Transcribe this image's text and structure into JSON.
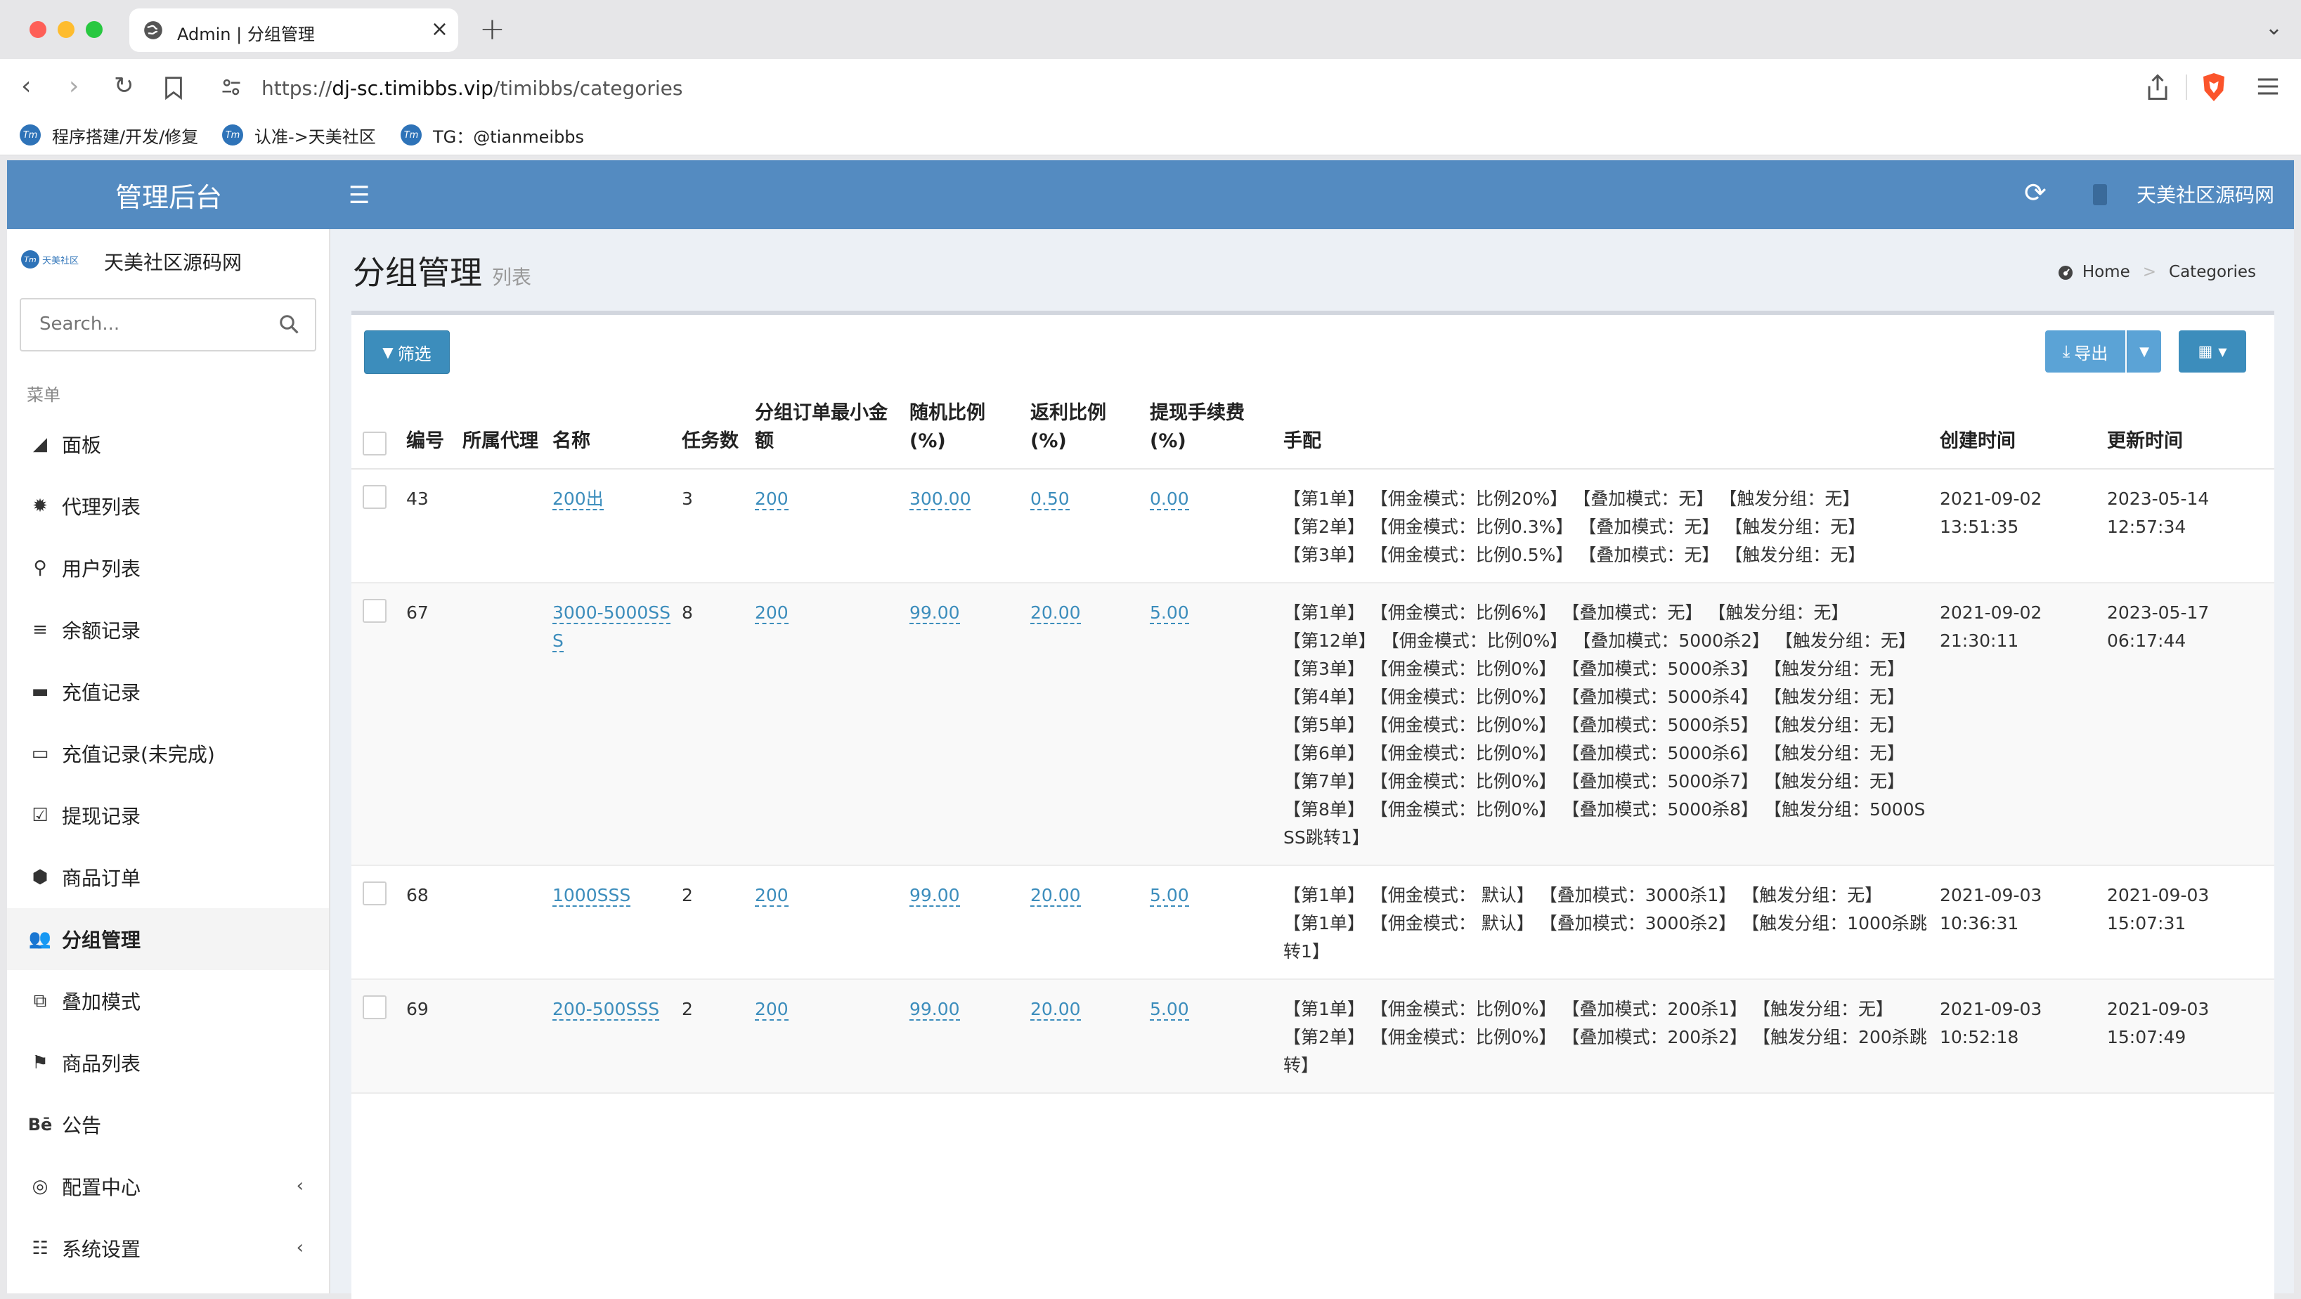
{
  "browser": {
    "tab_title": "Admin | 分组管理",
    "url_prefix": "https://",
    "url_host": "dj-sc.timibbs.vip",
    "url_path": "/timibbs/categories",
    "bookmarks": [
      {
        "label": "程序搭建/开发/修复"
      },
      {
        "label": "认准->天美社区"
      },
      {
        "label": "TG：@tianmeibbs"
      }
    ]
  },
  "header": {
    "brand": "管理后台",
    "user": "天美社区源码网"
  },
  "sidebar": {
    "logo_text": "天美社区",
    "site_name": "天美社区源码网",
    "search_placeholder": "Search...",
    "section": "菜单",
    "items": [
      {
        "label": "面板",
        "icon": "area-chart-icon"
      },
      {
        "label": "代理列表",
        "icon": "cog-icon"
      },
      {
        "label": "用户列表",
        "icon": "user-icon"
      },
      {
        "label": "余额记录",
        "icon": "bars-icon"
      },
      {
        "label": "充值记录",
        "icon": "battery-icon"
      },
      {
        "label": "充值记录(未完成)",
        "icon": "battery-empty-icon"
      },
      {
        "label": "提现记录",
        "icon": "check-square-icon"
      },
      {
        "label": "商品订单",
        "icon": "cube-icon"
      },
      {
        "label": "分组管理",
        "icon": "users-icon",
        "active": true
      },
      {
        "label": "叠加模式",
        "icon": "object-group-icon"
      },
      {
        "label": "商品列表",
        "icon": "wpexplorer-icon"
      },
      {
        "label": "公告",
        "icon": "behance-icon"
      },
      {
        "label": "配置中心",
        "icon": "life-ring-icon",
        "expandable": true
      },
      {
        "label": "系统设置",
        "icon": "server-icon",
        "expandable": true
      }
    ]
  },
  "page": {
    "title": "分组管理",
    "subtitle": "列表",
    "breadcrumb": [
      "Home",
      "Categories"
    ]
  },
  "toolbar": {
    "filter": "筛选",
    "export": "导出"
  },
  "table": {
    "headers": {
      "id": "编号",
      "agent": "所属代理",
      "name": "名称",
      "tasks": "任务数",
      "min_amount": "分组订单最小金额",
      "random_ratio": "随机比例(%)",
      "rebate_ratio": "返利比例(%)",
      "fee": "提现手续费(%)",
      "config": "手配",
      "created": "创建时间",
      "updated": "更新时间"
    },
    "rows": [
      {
        "id": "43",
        "agent": "",
        "name": "200出",
        "tasks": "3",
        "min_amount": "200",
        "random_ratio": "300.00",
        "rebate_ratio": "0.50",
        "fee": "0.00",
        "config": [
          "【第1单】 【佣金模式：比例20%】 【叠加模式：无】 【触发分组：无】",
          "【第2单】 【佣金模式：比例0.3%】 【叠加模式：无】 【触发分组：无】",
          "【第3单】 【佣金模式：比例0.5%】 【叠加模式：无】 【触发分组：无】"
        ],
        "created_date": "2021-09-02",
        "created_time": "13:51:35",
        "updated_date": "2023-05-14",
        "updated_time": "12:57:34"
      },
      {
        "id": "67",
        "agent": "",
        "name": "3000-5000SSS",
        "tasks": "8",
        "min_amount": "200",
        "random_ratio": "99.00",
        "rebate_ratio": "20.00",
        "fee": "5.00",
        "config": [
          "【第1单】 【佣金模式：比例6%】 【叠加模式：无】 【触发分组：无】",
          "【第12单】 【佣金模式：比例0%】 【叠加模式：5000杀2】 【触发分组：无】",
          "【第3单】 【佣金模式：比例0%】 【叠加模式：5000杀3】 【触发分组：无】",
          "【第4单】 【佣金模式：比例0%】 【叠加模式：5000杀4】 【触发分组：无】",
          "【第5单】 【佣金模式：比例0%】 【叠加模式：5000杀5】 【触发分组：无】",
          "【第6单】 【佣金模式：比例0%】 【叠加模式：5000杀6】 【触发分组：无】",
          "【第7单】 【佣金模式：比例0%】 【叠加模式：5000杀7】 【触发分组：无】",
          "【第8单】 【佣金模式：比例0%】 【叠加模式：5000杀8】 【触发分组：5000SSS跳转1】"
        ],
        "created_date": "2021-09-02",
        "created_time": "21:30:11",
        "updated_date": "2023-05-17",
        "updated_time": "06:17:44"
      },
      {
        "id": "68",
        "agent": "",
        "name": "1000SSS",
        "tasks": "2",
        "min_amount": "200",
        "random_ratio": "99.00",
        "rebate_ratio": "20.00",
        "fee": "5.00",
        "config": [
          "【第1单】 【佣金模式： 默认】 【叠加模式：3000杀1】 【触发分组：无】",
          "【第1单】 【佣金模式： 默认】 【叠加模式：3000杀2】 【触发分组：1000杀跳转1】"
        ],
        "created_date": "2021-09-03",
        "created_time": "10:36:31",
        "updated_date": "2021-09-03",
        "updated_time": "15:07:31"
      },
      {
        "id": "69",
        "agent": "",
        "name": "200-500SSS",
        "tasks": "2",
        "min_amount": "200",
        "random_ratio": "99.00",
        "rebate_ratio": "20.00",
        "fee": "5.00",
        "config": [
          "【第1单】 【佣金模式：比例0%】 【叠加模式：200杀1】 【触发分组：无】",
          "【第2单】 【佣金模式：比例0%】 【叠加模式：200杀2】 【触发分组：200杀跳转】"
        ],
        "created_date": "2021-09-03",
        "created_time": "10:52:18",
        "updated_date": "2021-09-03",
        "updated_time": "15:07:49"
      }
    ]
  }
}
